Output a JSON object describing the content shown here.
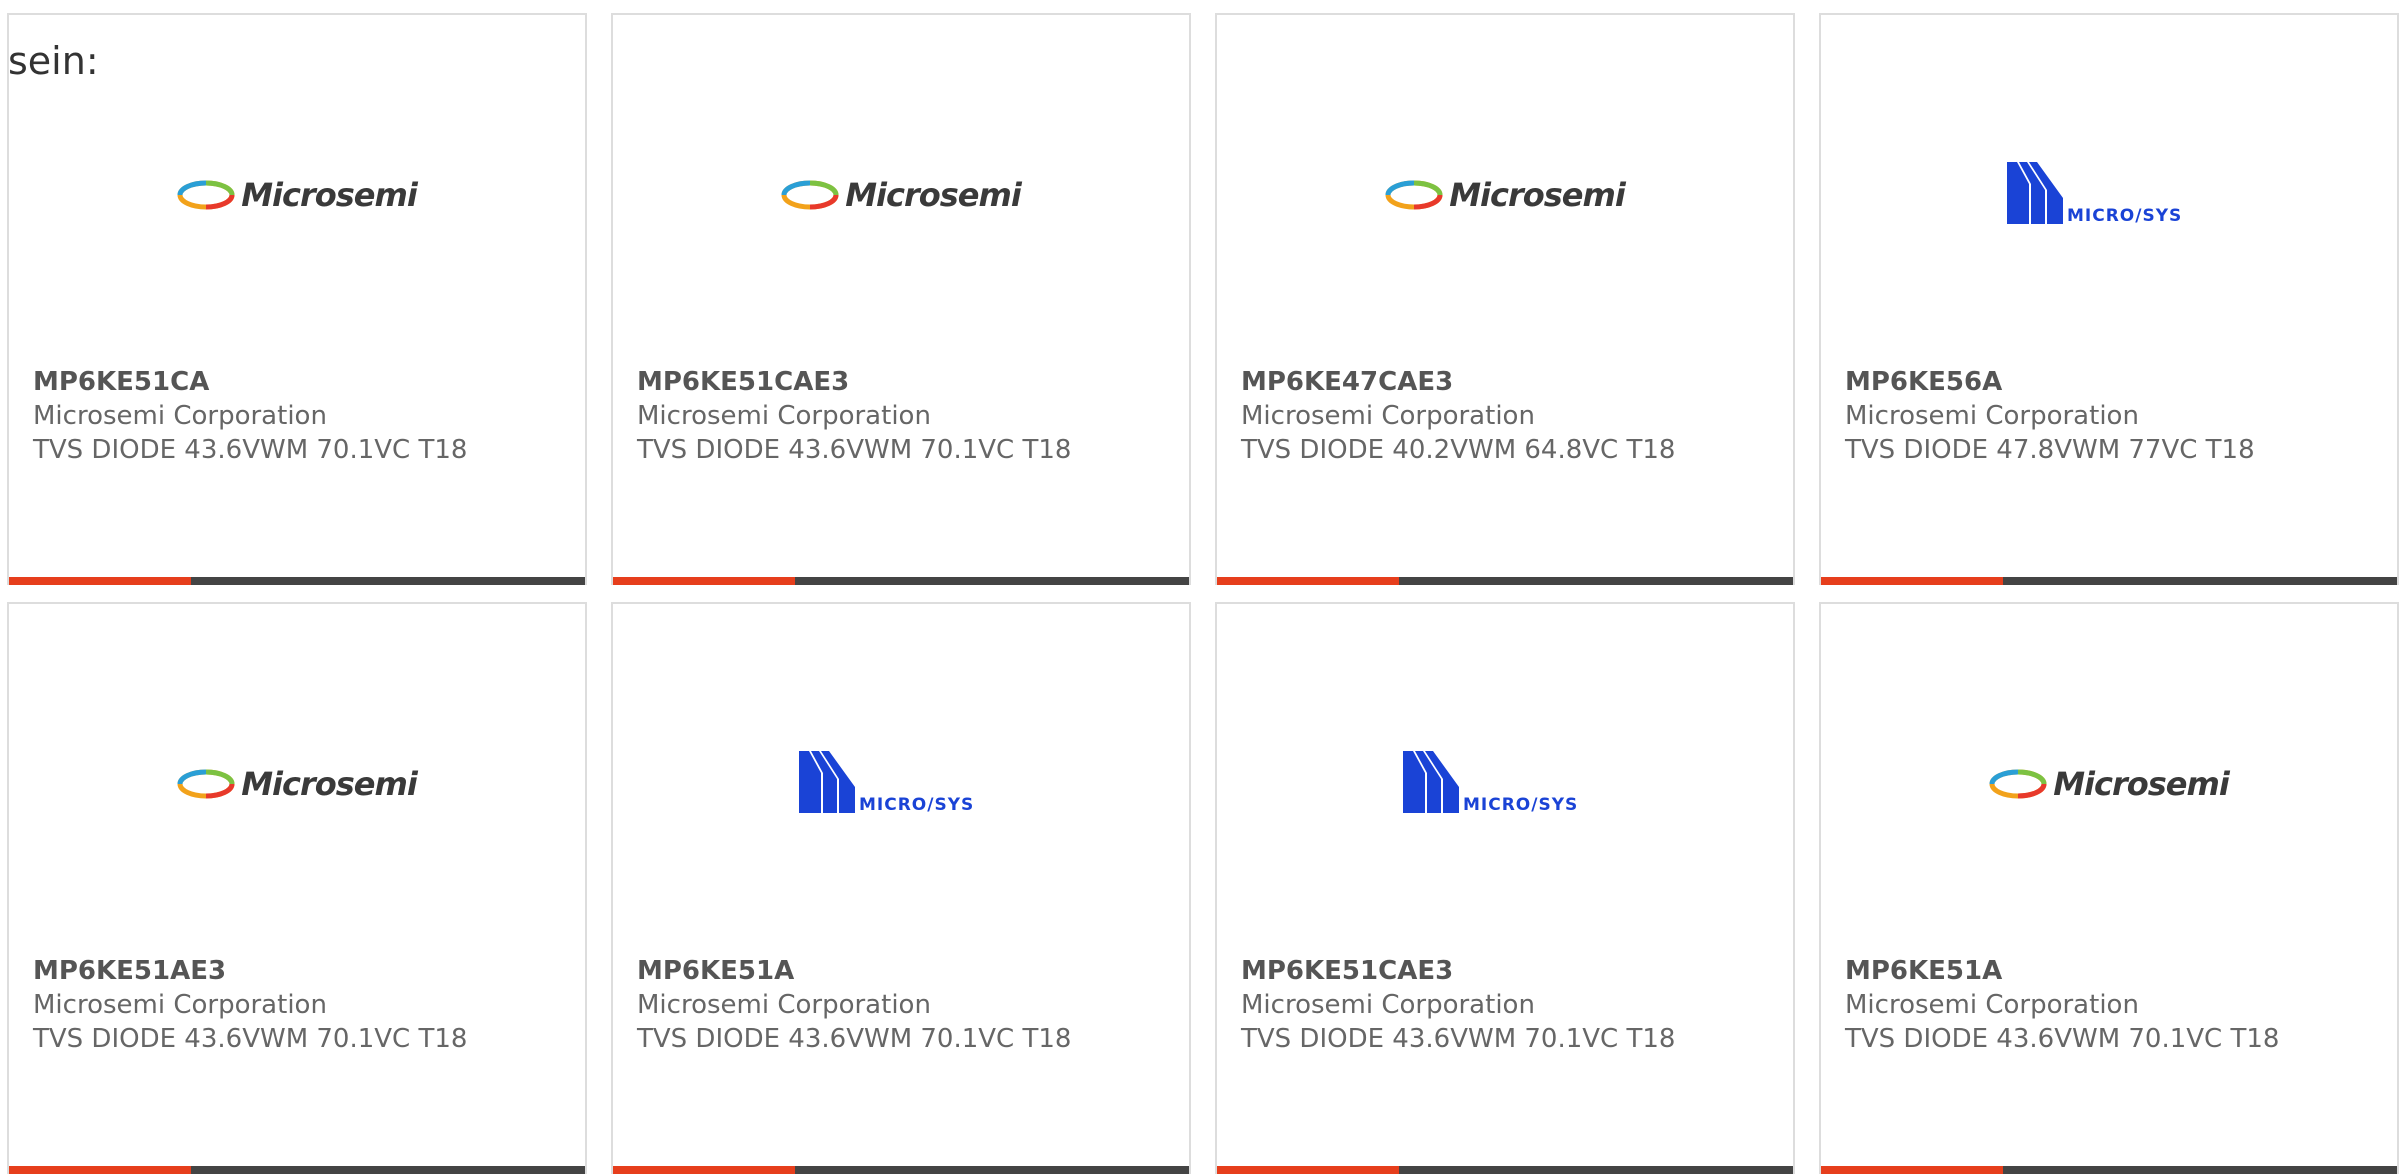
{
  "intro_text": "sein:",
  "colors": {
    "accent_bar": "#e63e1c",
    "bar_base": "#444444",
    "microsys_blue": "#1a43d6"
  },
  "products": [
    {
      "part": "MP6KE51CA",
      "manufacturer": "Microsemi Corporation",
      "description": "TVS DIODE 43.6VWM 70.1VC T18",
      "logo": "microsemi-logo",
      "logo_text": "Microsemi"
    },
    {
      "part": "MP6KE51CAE3",
      "manufacturer": "Microsemi Corporation",
      "description": "TVS DIODE 43.6VWM 70.1VC T18",
      "logo": "microsemi-logo",
      "logo_text": "Microsemi"
    },
    {
      "part": "MP6KE47CAE3",
      "manufacturer": "Microsemi Corporation",
      "description": "TVS DIODE 40.2VWM 64.8VC T18",
      "logo": "microsemi-logo",
      "logo_text": "Microsemi"
    },
    {
      "part": "MP6KE56A",
      "manufacturer": "Microsemi Corporation",
      "description": "TVS DIODE 47.8VWM 77VC T18",
      "logo": "microsys-logo",
      "logo_text": "MICRO/SYS"
    },
    {
      "part": "MP6KE51AE3",
      "manufacturer": "Microsemi Corporation",
      "description": "TVS DIODE 43.6VWM 70.1VC T18",
      "logo": "microsemi-logo",
      "logo_text": "Microsemi"
    },
    {
      "part": "MP6KE51A",
      "manufacturer": "Microsemi Corporation",
      "description": "TVS DIODE 43.6VWM 70.1VC T18",
      "logo": "microsys-logo",
      "logo_text": "MICRO/SYS"
    },
    {
      "part": "MP6KE51CAE3",
      "manufacturer": "Microsemi Corporation",
      "description": "TVS DIODE 43.6VWM 70.1VC T18",
      "logo": "microsys-logo",
      "logo_text": "MICRO/SYS"
    },
    {
      "part": "MP6KE51A",
      "manufacturer": "Microsemi Corporation",
      "description": "TVS DIODE 43.6VWM 70.1VC T18",
      "logo": "microsemi-logo",
      "logo_text": "Microsemi"
    }
  ]
}
